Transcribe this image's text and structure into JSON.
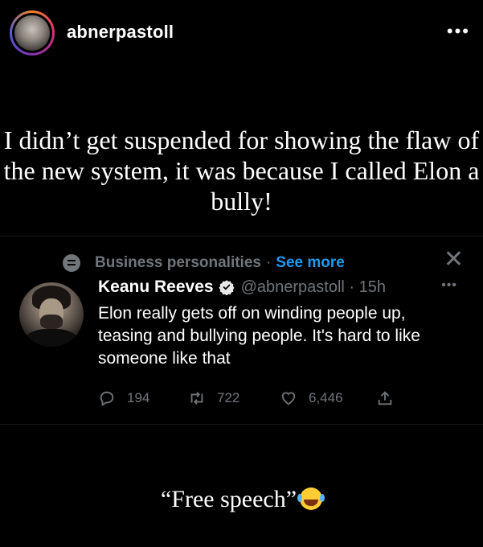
{
  "post": {
    "username": "abnerpastoll",
    "more_icon": "more-horizontal-icon",
    "caption": "I didn’t get suspended for showing the flaw of the new system, it was because I called Elon a bully!",
    "footer_caption": "“Free speech”",
    "footer_emoji": "face-with-tears-of-joy-emoji"
  },
  "tweet": {
    "topic": "Business personalities",
    "separator": "·",
    "see_more": "See more",
    "name": "Keanu Reeves",
    "handle": "@abnerpastoll · 15h",
    "text": "Elon really gets off on winding people up, teasing and bullying people. It's hard to like someone like that",
    "replies": "194",
    "retweets": "722",
    "likes": "6,446"
  },
  "colors": {
    "background": "#000000",
    "muted": "#71767b",
    "link": "#1d9bf0",
    "verified": "#1d9bf0"
  }
}
